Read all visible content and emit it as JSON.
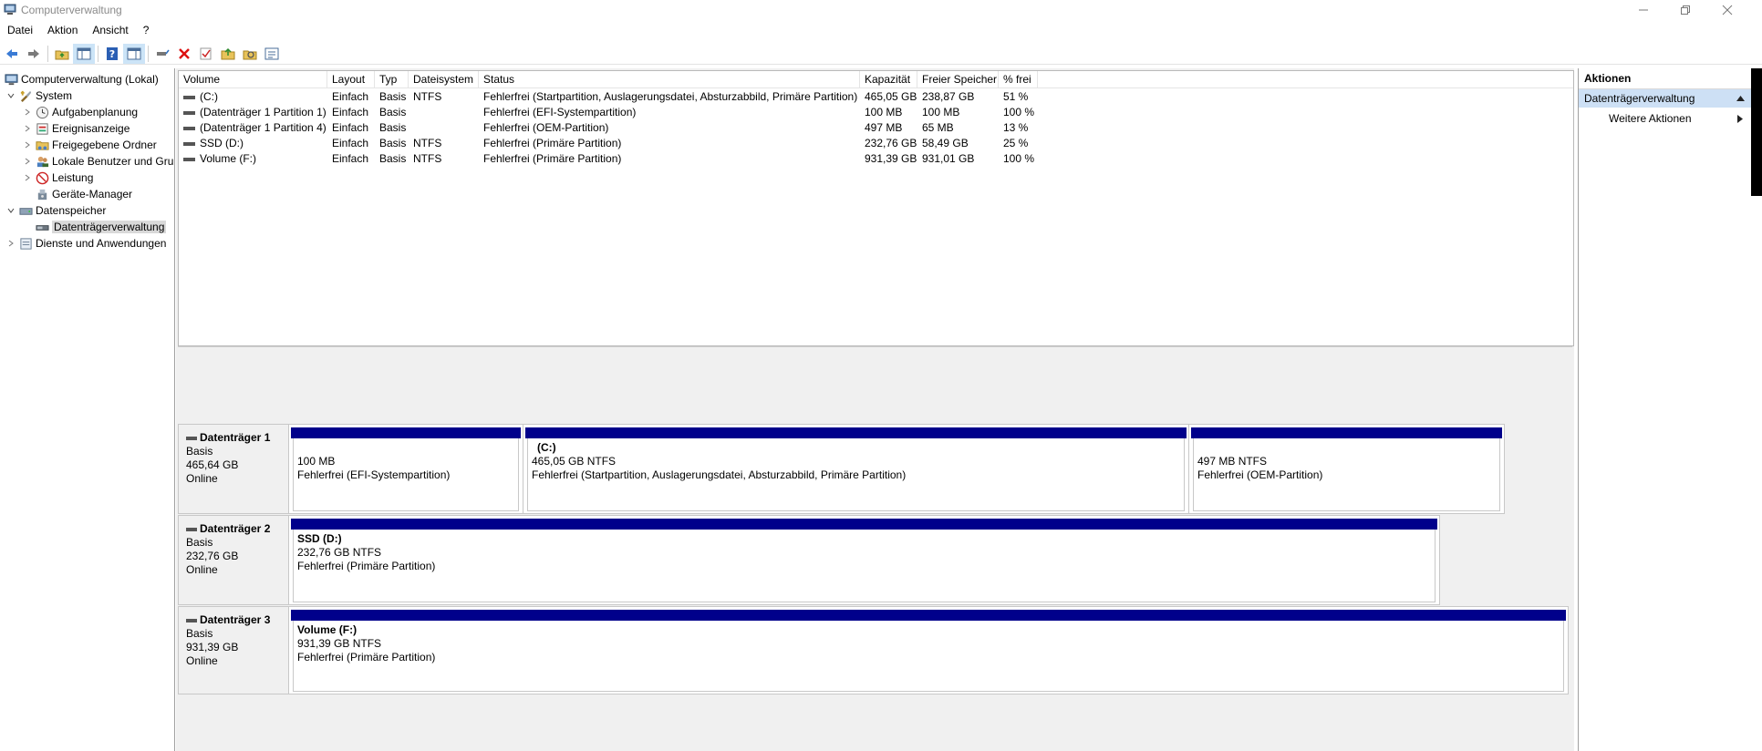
{
  "window": {
    "title": "Computerverwaltung"
  },
  "menu": {
    "items": [
      "Datei",
      "Aktion",
      "Ansicht",
      "?"
    ]
  },
  "toolbar": {
    "icons": [
      "back-arrow-icon",
      "forward-arrow-icon",
      "up-folder-icon",
      "show-tree-icon",
      "help-icon",
      "console-icon",
      "connect-icon",
      "delete-icon",
      "check-icon",
      "folder-up-icon",
      "search-icon",
      "properties-icon"
    ]
  },
  "tree": {
    "root": "Computerverwaltung (Lokal)",
    "system": "System",
    "aufgabenplanung": "Aufgabenplanung",
    "ereignisanzeige": "Ereignisanzeige",
    "freigegebene": "Freigegebene Ordner",
    "lokale": "Lokale Benutzer und Gru",
    "leistung": "Leistung",
    "geraete": "Geräte-Manager",
    "datenspeicher": "Datenspeicher",
    "datentraeger": "Datenträgerverwaltung",
    "dienste": "Dienste und Anwendungen"
  },
  "volumes": {
    "headers": [
      "Volume",
      "Layout",
      "Typ",
      "Dateisystem",
      "Status",
      "Kapazität",
      "Freier Speicher",
      "% frei"
    ],
    "rows": [
      [
        "(C:)",
        "Einfach",
        "Basis",
        "NTFS",
        "Fehlerfrei (Startpartition, Auslagerungsdatei, Absturzabbild, Primäre Partition)",
        "465,05 GB",
        "238,87 GB",
        "51 %"
      ],
      [
        "(Datenträger 1 Partition 1)",
        "Einfach",
        "Basis",
        "",
        "Fehlerfrei (EFI-Systempartition)",
        "100 MB",
        "100 MB",
        "100 %"
      ],
      [
        "(Datenträger 1 Partition 4)",
        "Einfach",
        "Basis",
        "",
        "Fehlerfrei (OEM-Partition)",
        "497 MB",
        "65 MB",
        "13 %"
      ],
      [
        "SSD (D:)",
        "Einfach",
        "Basis",
        "NTFS",
        "Fehlerfrei (Primäre Partition)",
        "232,76 GB",
        "58,49 GB",
        "25 %"
      ],
      [
        "Volume (F:)",
        "Einfach",
        "Basis",
        "NTFS",
        "Fehlerfrei (Primäre Partition)",
        "931,39 GB",
        "931,01 GB",
        "100 %"
      ]
    ]
  },
  "disks": {
    "d1": {
      "name": "Datenträger 1",
      "type": "Basis",
      "size": "465,64 GB",
      "state": "Online",
      "p1": {
        "size": "100 MB",
        "status": "Fehlerfrei (EFI-Systempartition)"
      },
      "p2": {
        "name": "(C:)",
        "size": "465,05 GB NTFS",
        "status": "Fehlerfrei (Startpartition, Auslagerungsdatei, Absturzabbild, Primäre Partition)"
      },
      "p3": {
        "size": "497 MB NTFS",
        "status": "Fehlerfrei (OEM-Partition)"
      }
    },
    "d2": {
      "name": "Datenträger 2",
      "type": "Basis",
      "size": "232,76 GB",
      "state": "Online",
      "p1": {
        "name": "SSD  (D:)",
        "size": "232,76 GB NTFS",
        "status": "Fehlerfrei (Primäre Partition)"
      }
    },
    "d3": {
      "name": "Datenträger 3",
      "type": "Basis",
      "size": "931,39 GB",
      "state": "Online",
      "p1": {
        "name": "Volume  (F:)",
        "size": "931,39 GB NTFS",
        "status": "Fehlerfrei (Primäre Partition)"
      }
    }
  },
  "actions": {
    "header": "Aktionen",
    "section": "Datenträgerverwaltung",
    "item": "Weitere Aktionen"
  },
  "colors": {
    "partition_bar": "#00008b",
    "selection": "#cde0f5"
  }
}
